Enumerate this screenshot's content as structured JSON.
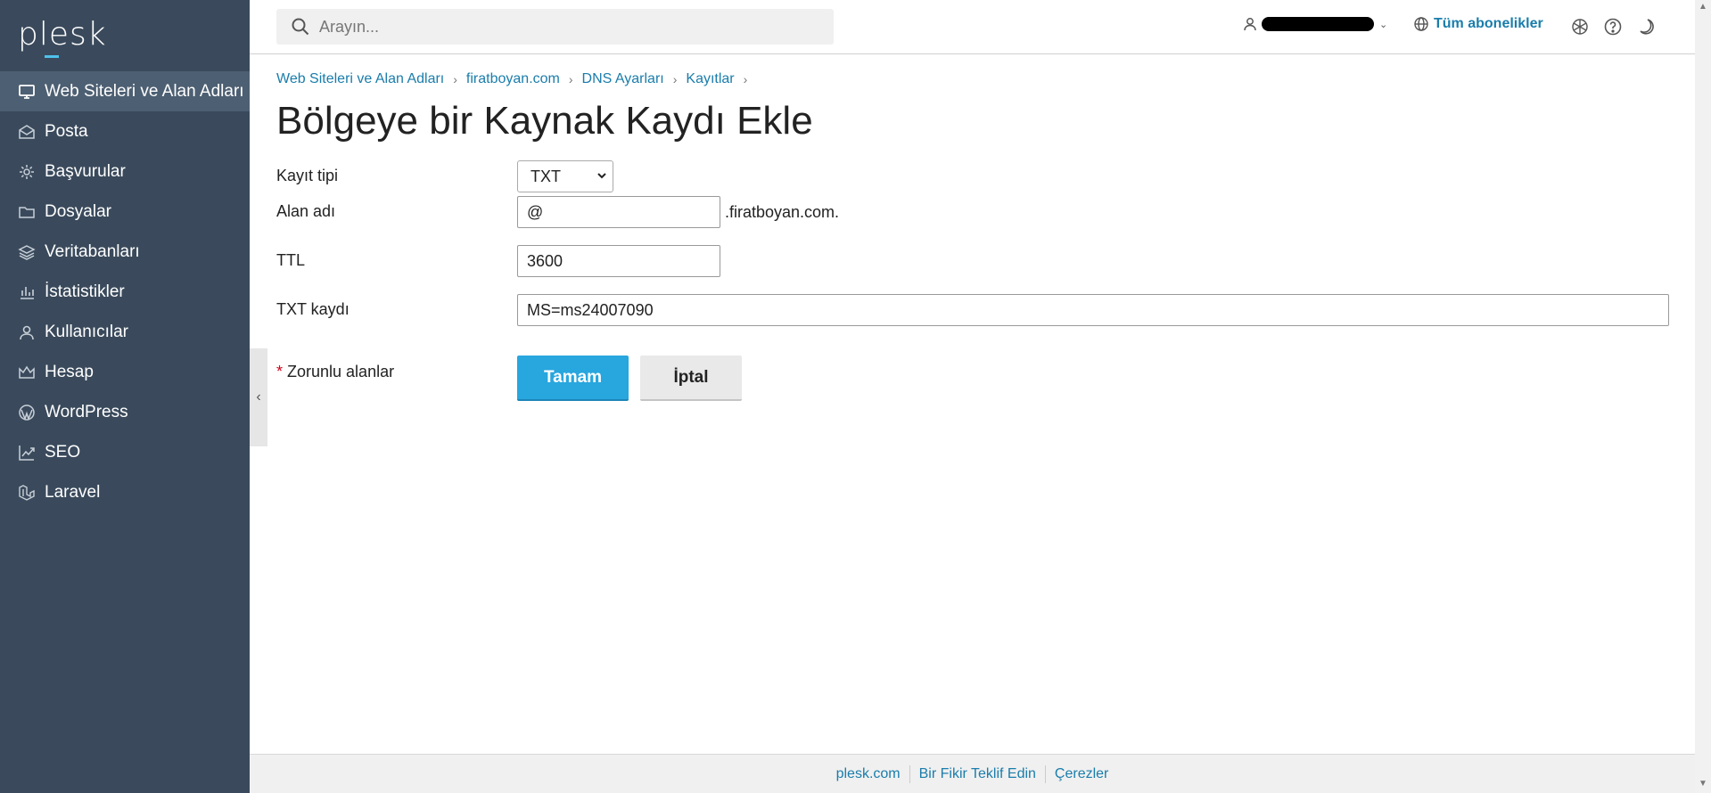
{
  "brand": {
    "logo_text": "plesk",
    "accent": "#4fc1ea",
    "sidebar_bg": "#3a4a5c",
    "link_color": "#1a7dab",
    "primary_button": "#28a6de"
  },
  "sidebar": {
    "items": [
      {
        "label": "Web Siteleri ve Alan Adları",
        "icon": "monitor-icon",
        "active": true
      },
      {
        "label": "Posta",
        "icon": "envelope-icon"
      },
      {
        "label": "Başvurular",
        "icon": "gear-icon"
      },
      {
        "label": "Dosyalar",
        "icon": "folder-icon"
      },
      {
        "label": "Veritabanları",
        "icon": "layers-icon"
      },
      {
        "label": "İstatistikler",
        "icon": "bar-chart-icon"
      },
      {
        "label": "Kullanıcılar",
        "icon": "user-icon"
      },
      {
        "label": "Hesap",
        "icon": "crown-icon"
      },
      {
        "label": "WordPress",
        "icon": "wordpress-icon"
      },
      {
        "label": "SEO",
        "icon": "trend-chart-icon"
      },
      {
        "label": "Laravel",
        "icon": "laravel-icon"
      }
    ]
  },
  "topbar": {
    "search_placeholder": "Arayın...",
    "subscriptions_label": "Tüm abonelikler"
  },
  "breadcrumb": [
    "Web Siteleri ve Alan Adları",
    "firatboyan.com",
    "DNS Ayarları",
    "Kayıtlar"
  ],
  "page": {
    "title": "Bölgeye bir Kaynak Kaydı Ekle"
  },
  "form": {
    "record_type_label": "Kayıt tipi",
    "record_type_value": "TXT",
    "domain_label": "Alan adı",
    "domain_value": "@",
    "domain_suffix": ".firatboyan.com.",
    "ttl_label": "TTL",
    "ttl_value": "3600",
    "txt_label": "TXT kaydı",
    "txt_value": "MS=ms24007090",
    "required_star": "*",
    "required_label": "Zorunlu alanlar",
    "ok_label": "Tamam",
    "cancel_label": "İptal"
  },
  "footer": {
    "links": [
      "plesk.com",
      "Bir Fikir Teklif Edin",
      "Çerezler"
    ]
  }
}
